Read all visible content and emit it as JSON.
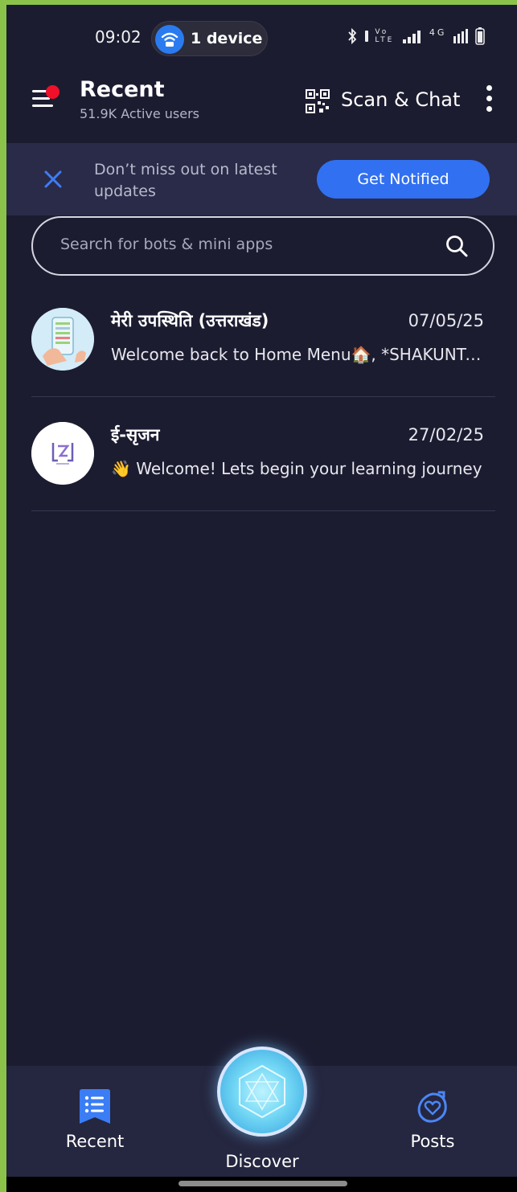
{
  "status_bar": {
    "time": "09:02",
    "device_pill": "1 device",
    "icons": [
      "bluetooth-icon",
      "volte-icon",
      "signal-icon",
      "4g-signal-icon",
      "battery-icon"
    ],
    "volte_text": "Vo LTE",
    "net_text": "4G"
  },
  "header": {
    "title": "Recent",
    "subtitle": "51.9K Active users",
    "scan_label": "Scan & Chat"
  },
  "banner": {
    "message": "Don’t miss out on latest updates",
    "button": "Get Notified"
  },
  "search": {
    "placeholder": "Search for bots & mini apps"
  },
  "chats": [
    {
      "name": "मेरी उपस्थिति (उत्तराखंड)",
      "date": "07/05/25",
      "preview": "Welcome back to Home Menu🏠, *SHAKUNTALA*"
    },
    {
      "name": "ई-सृजन",
      "date": "27/02/25",
      "preview": "👋 Welcome! Lets begin your learning journey"
    }
  ],
  "bottom_nav": {
    "recent": "Recent",
    "discover": "Discover",
    "posts": "Posts"
  },
  "colors": {
    "background": "#1c1c31",
    "banner": "#2a2b48",
    "accent": "#3170f0",
    "notification_dot": "#f0102a",
    "nav_bg": "#25263f"
  }
}
